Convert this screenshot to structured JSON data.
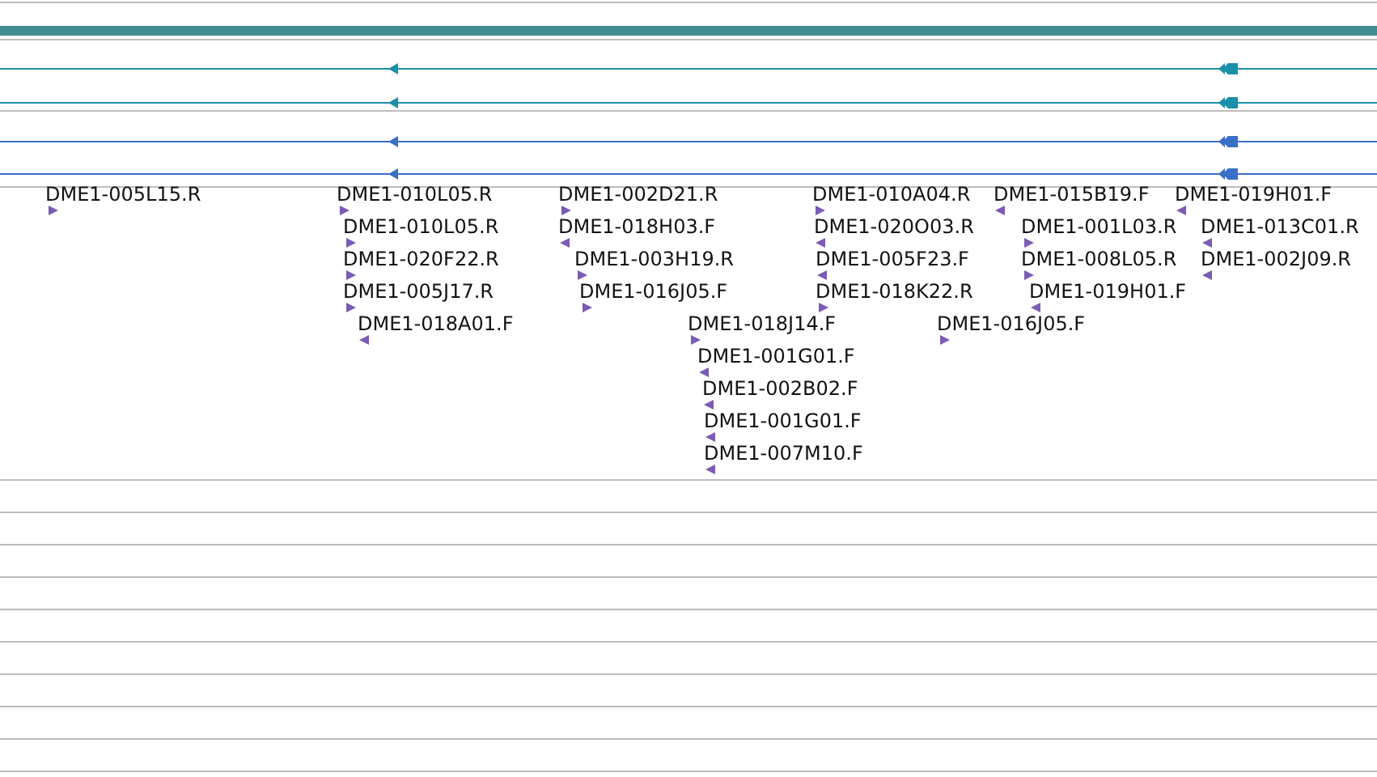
{
  "tracks": [
    {
      "color": "#1a8fa8"
    },
    {
      "color": "#1a8fa8"
    },
    {
      "color": "#3a6fc8"
    },
    {
      "color": "#3a6fc8"
    }
  ],
  "features": [
    {
      "label": "DME1-005L15.R",
      "reverse": false
    },
    {
      "label": "DME1-010L05.R",
      "reverse": false
    },
    {
      "label": "DME1-002D21.R",
      "reverse": false
    },
    {
      "label": "DME1-010A04.R",
      "reverse": false
    },
    {
      "label": "DME1-015B19.F",
      "reverse": true
    },
    {
      "label": "DME1-019H01.F",
      "reverse": true
    },
    {
      "label": "DME1-010L05.R",
      "reverse": false
    },
    {
      "label": "DME1-018H03.F",
      "reverse": true
    },
    {
      "label": "DME1-020O03.R",
      "reverse": true
    },
    {
      "label": "DME1-001L03.R",
      "reverse": false
    },
    {
      "label": "DME1-013C01.R",
      "reverse": true
    },
    {
      "label": "DME1-020F22.R",
      "reverse": false
    },
    {
      "label": "DME1-003H19.R",
      "reverse": false
    },
    {
      "label": "DME1-005F23.F",
      "reverse": true
    },
    {
      "label": "DME1-008L05.R",
      "reverse": false
    },
    {
      "label": "DME1-002J09.R",
      "reverse": true
    },
    {
      "label": "DME1-005J17.R",
      "reverse": false
    },
    {
      "label": "DME1-016J05.F",
      "reverse": false
    },
    {
      "label": "DME1-018K22.R",
      "reverse": false
    },
    {
      "label": "DME1-019H01.F",
      "reverse": true
    },
    {
      "label": "DME1-018A01.F",
      "reverse": true
    },
    {
      "label": "DME1-018J14.F",
      "reverse": false
    },
    {
      "label": "DME1-016J05.F",
      "reverse": false
    },
    {
      "label": "DME1-001G01.F",
      "reverse": true
    },
    {
      "label": "DME1-002B02.F",
      "reverse": true
    },
    {
      "label": "DME1-001G01.F",
      "reverse": true
    },
    {
      "label": "DME1-007M10.F",
      "reverse": true
    }
  ]
}
